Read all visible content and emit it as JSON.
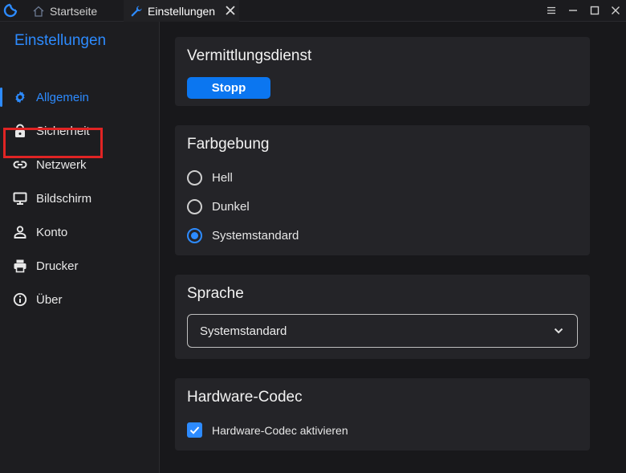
{
  "titlebar": {
    "tabs": [
      {
        "label": "Startseite",
        "icon": "home-icon"
      },
      {
        "label": "Einstellungen",
        "icon": "wrench-icon"
      }
    ]
  },
  "sidebar": {
    "title": "Einstellungen",
    "items": [
      {
        "label": "Allgemein",
        "icon": "gear-icon",
        "active": true
      },
      {
        "label": "Sicherheit",
        "icon": "lock-icon"
      },
      {
        "label": "Netzwerk",
        "icon": "link-icon"
      },
      {
        "label": "Bildschirm",
        "icon": "monitor-icon"
      },
      {
        "label": "Konto",
        "icon": "user-icon"
      },
      {
        "label": "Drucker",
        "icon": "printer-icon"
      },
      {
        "label": "Über",
        "icon": "info-icon"
      }
    ]
  },
  "main": {
    "service": {
      "title": "Vermittlungsdienst",
      "button": "Stopp"
    },
    "theme": {
      "title": "Farbgebung",
      "options": [
        {
          "label": "Hell",
          "checked": false
        },
        {
          "label": "Dunkel",
          "checked": false
        },
        {
          "label": "Systemstandard",
          "checked": true
        }
      ]
    },
    "language": {
      "title": "Sprache",
      "selected": "Systemstandard"
    },
    "codec": {
      "title": "Hardware-Codec",
      "checkbox_label": "Hardware-Codec aktivieren",
      "checked": true
    }
  },
  "colors": {
    "accent": "#2d8bff",
    "button": "#0b76f0",
    "highlight": "#e02424"
  }
}
